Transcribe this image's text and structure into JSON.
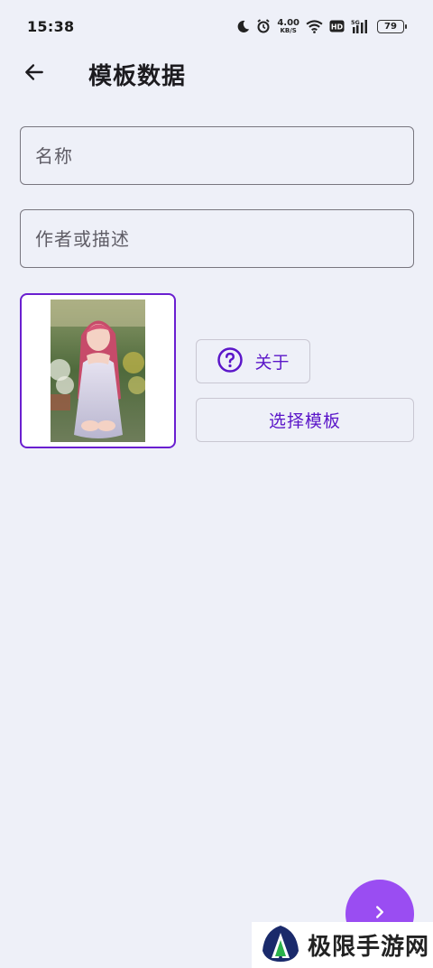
{
  "status_bar": {
    "time": "15:38",
    "net_speed_value": "4.00",
    "net_speed_unit": "KB/S",
    "hd_label": "HD",
    "network_label": "5G",
    "battery_level": "79",
    "icons": [
      "moon-icon",
      "alarm-icon",
      "wifi-icon",
      "hd-icon",
      "signal-icon",
      "battery-icon"
    ]
  },
  "app_bar": {
    "title": "模板数据",
    "back_icon": "arrow-back-icon"
  },
  "form": {
    "name_placeholder": "名称",
    "name_value": "",
    "author_placeholder": "作者或描述",
    "author_value": ""
  },
  "actions": {
    "about_label": "关于",
    "about_icon": "help-circle-icon",
    "choose_template_label": "选择模板"
  },
  "fab": {
    "icon": "chevron-right-icon"
  },
  "watermark": {
    "text": "极限手游网"
  },
  "colors": {
    "background": "#eef0f8",
    "accent": "#5b16c9",
    "fab": "#9a4df2",
    "image_border": "#6a1fd0"
  }
}
